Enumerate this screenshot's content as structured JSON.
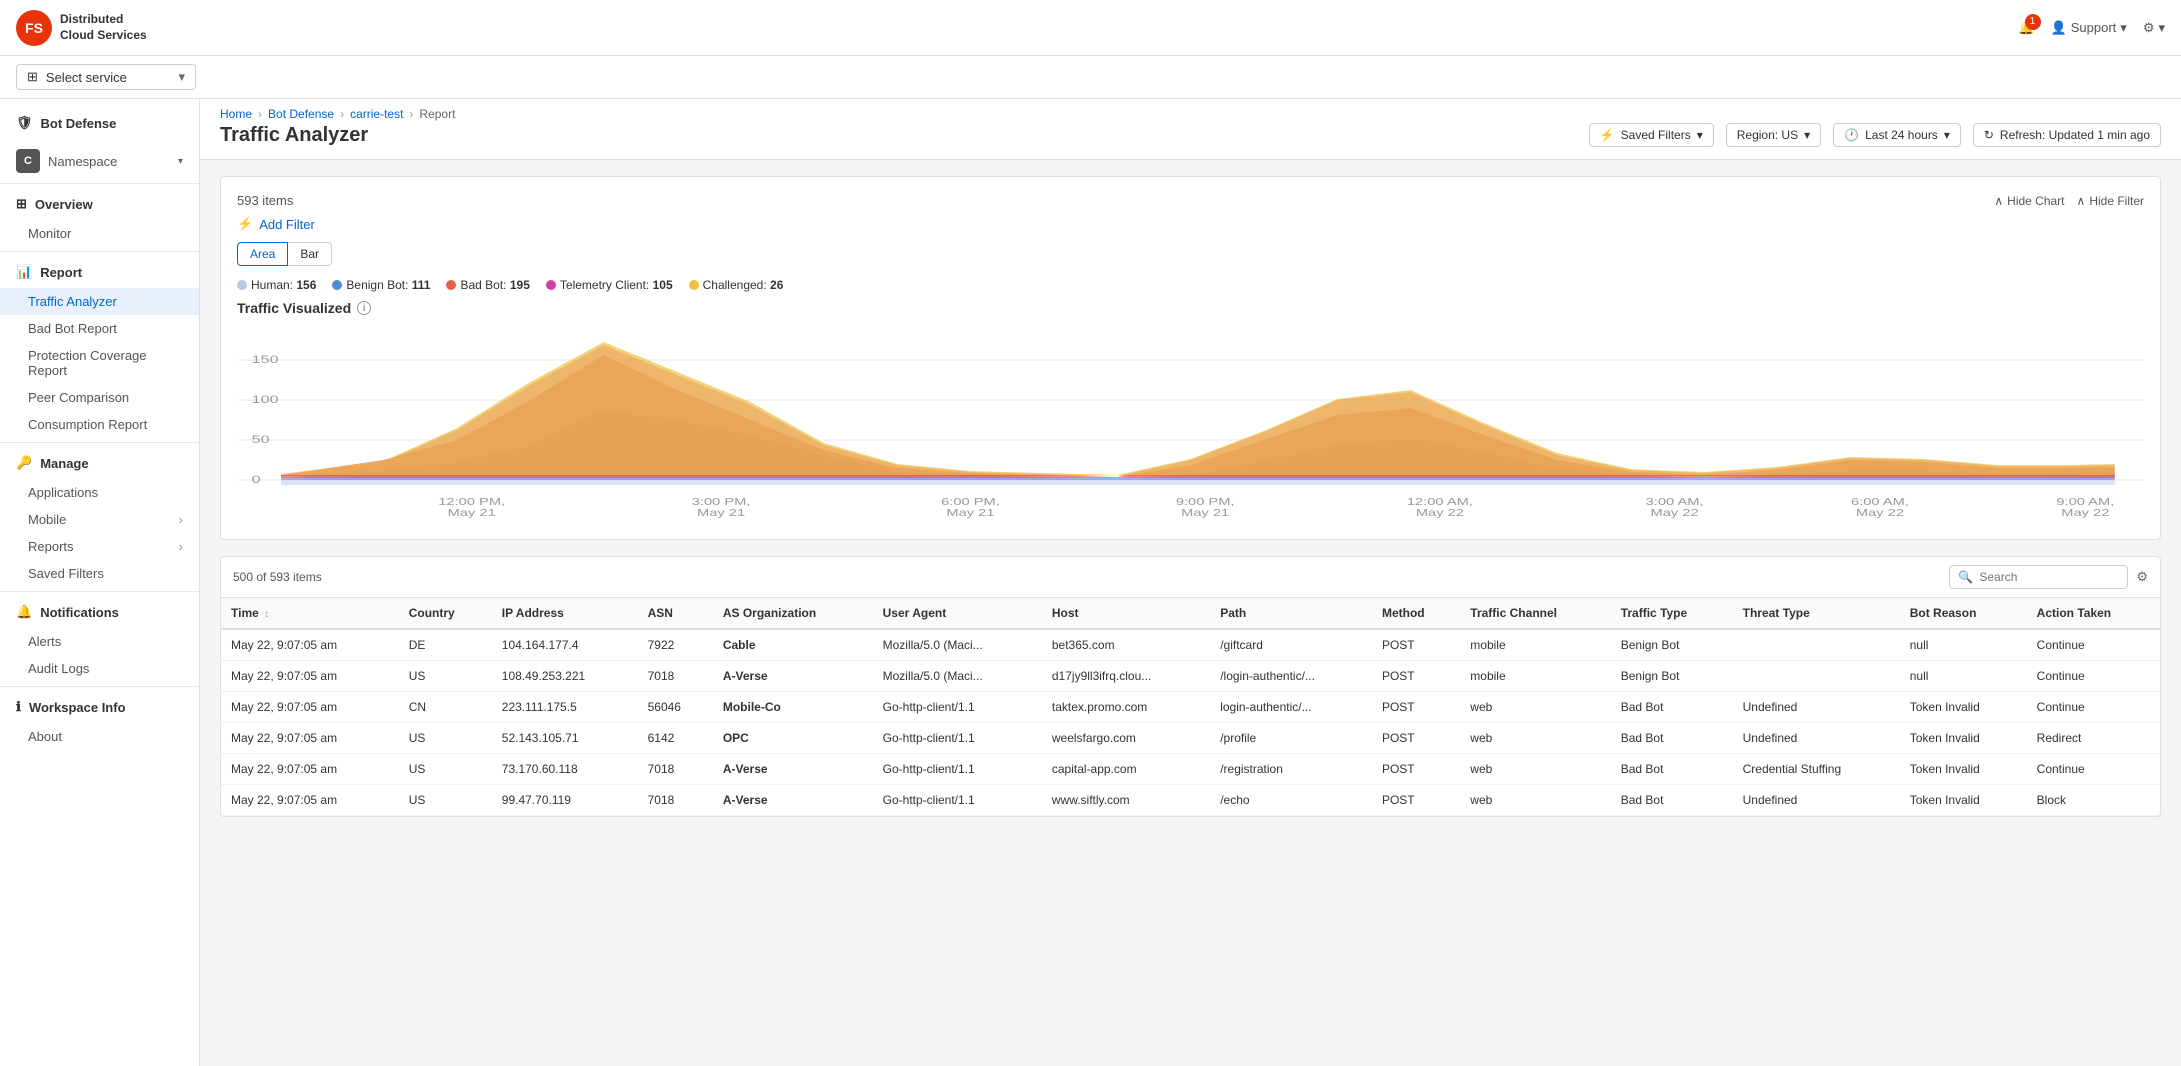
{
  "topbar": {
    "logo_initials": "FS",
    "logo_text_line1": "Distributed",
    "logo_text_line2": "Cloud Services",
    "notification_count": "1",
    "support_label": "Support",
    "user_label": ""
  },
  "service_bar": {
    "select_label": "Select service",
    "arrow": "▾"
  },
  "breadcrumb": {
    "items": [
      "Home",
      "Bot Defense",
      "carrie-test",
      "Report"
    ]
  },
  "page_title": "Traffic Analyzer",
  "filter_bar": {
    "saved_filters": "Saved Filters",
    "region": "Region: US",
    "time_range": "Last 24 hours",
    "refresh": "Refresh: Updated 1 min ago"
  },
  "sidebar": {
    "bot_defense_label": "Bot Defense",
    "namespace_label": "Namespace",
    "overview_label": "Overview",
    "overview_sub": [
      "Monitor"
    ],
    "report_label": "Report",
    "report_items": [
      "Traffic Analyzer",
      "Bad Bot Report",
      "Protection Coverage Report",
      "Peer Comparison",
      "Consumption Report"
    ],
    "manage_label": "Manage",
    "manage_items": [
      "Applications",
      "Mobile",
      "Reports",
      "Saved Filters"
    ],
    "notifications_label": "Notifications",
    "notifications_items": [
      "Alerts",
      "Audit Logs"
    ],
    "workspace_label": "Workspace Info",
    "workspace_items": [
      "About"
    ]
  },
  "chart": {
    "items_count": "593 items",
    "hide_chart": "Hide Chart",
    "hide_filter": "Hide Filter",
    "add_filter": "Add Filter",
    "type_area": "Area",
    "type_bar": "Bar",
    "legend": [
      {
        "label": "Human:",
        "value": "156",
        "color": "#b8c9e8"
      },
      {
        "label": "Benign Bot:",
        "value": "111",
        "color": "#4e8cd4"
      },
      {
        "label": "Bad Bot:",
        "value": "195",
        "color": "#e8604a"
      },
      {
        "label": "Telemetry Client:",
        "value": "105",
        "color": "#d040a0"
      },
      {
        "label": "Challenged:",
        "value": "26",
        "color": "#f0c040"
      }
    ],
    "chart_title": "Traffic Visualized",
    "y_labels": [
      "0",
      "50",
      "100",
      "150"
    ],
    "x_labels": [
      "12:00 PM, May 21",
      "3:00 PM, May 21",
      "6:00 PM, May 21",
      "9:00 PM, May 21",
      "12:00 AM, May 22",
      "3:00 AM, May 22",
      "6:00 AM, May 22",
      "9:00 AM, May 22"
    ]
  },
  "table": {
    "count": "500 of 593 items",
    "search_placeholder": "Search",
    "columns": [
      "Time",
      "Country",
      "IP Address",
      "ASN",
      "AS Organization",
      "User Agent",
      "Host",
      "Path",
      "Method",
      "Traffic Channel",
      "Traffic Type",
      "Threat Type",
      "Bot Reason",
      "Action Taken"
    ],
    "rows": [
      {
        "time": "May 22, 9:07:05 am",
        "country": "DE",
        "ip": "104.164.177.4",
        "asn": "7922",
        "as_org": "Cable",
        "user_agent": "Mozilla/5.0 (Maci...",
        "host": "bet365.com",
        "path": "/giftcard",
        "method": "POST",
        "channel": "mobile",
        "type": "Benign Bot",
        "threat": "",
        "bot_reason": "null",
        "action": "Continue"
      },
      {
        "time": "May 22, 9:07:05 am",
        "country": "US",
        "ip": "108.49.253.221",
        "asn": "7018",
        "as_org": "A-Verse",
        "user_agent": "Mozilla/5.0 (Maci...",
        "host": "d17jy9ll3ifrq.clou...",
        "path": "/login-authentic/...",
        "method": "POST",
        "channel": "mobile",
        "type": "Benign Bot",
        "threat": "",
        "bot_reason": "null",
        "action": "Continue"
      },
      {
        "time": "May 22, 9:07:05 am",
        "country": "CN",
        "ip": "223.111.175.5",
        "asn": "56046",
        "as_org": "Mobile-Co",
        "user_agent": "Go-http-client/1.1",
        "host": "taktex.promo.com",
        "path": "login-authentic/...",
        "method": "POST",
        "channel": "web",
        "type": "Bad Bot",
        "threat": "Undefined",
        "bot_reason": "Token Invalid",
        "action": "Continue"
      },
      {
        "time": "May 22, 9:07:05 am",
        "country": "US",
        "ip": "52.143.105.71",
        "asn": "6142",
        "as_org": "OPC",
        "user_agent": "Go-http-client/1.1",
        "host": "weelsfargo.com",
        "path": "/profile",
        "method": "POST",
        "channel": "web",
        "type": "Bad Bot",
        "threat": "Undefined",
        "bot_reason": "Token Invalid",
        "action": "Redirect"
      },
      {
        "time": "May 22, 9:07:05 am",
        "country": "US",
        "ip": "73.170.60.118",
        "asn": "7018",
        "as_org": "A-Verse",
        "user_agent": "Go-http-client/1.1",
        "host": "capital-app.com",
        "path": "/registration",
        "method": "POST",
        "channel": "web",
        "type": "Bad Bot",
        "threat": "Credential Stuffing",
        "bot_reason": "Token Invalid",
        "action": "Continue"
      },
      {
        "time": "May 22, 9:07:05 am",
        "country": "US",
        "ip": "99.47.70.119",
        "asn": "7018",
        "as_org": "A-Verse",
        "user_agent": "Go-http-client/1.1",
        "host": "www.siftly.com",
        "path": "/echo",
        "method": "POST",
        "channel": "web",
        "type": "Bad Bot",
        "threat": "Undefined",
        "bot_reason": "Token Invalid",
        "action": "Block"
      }
    ]
  }
}
